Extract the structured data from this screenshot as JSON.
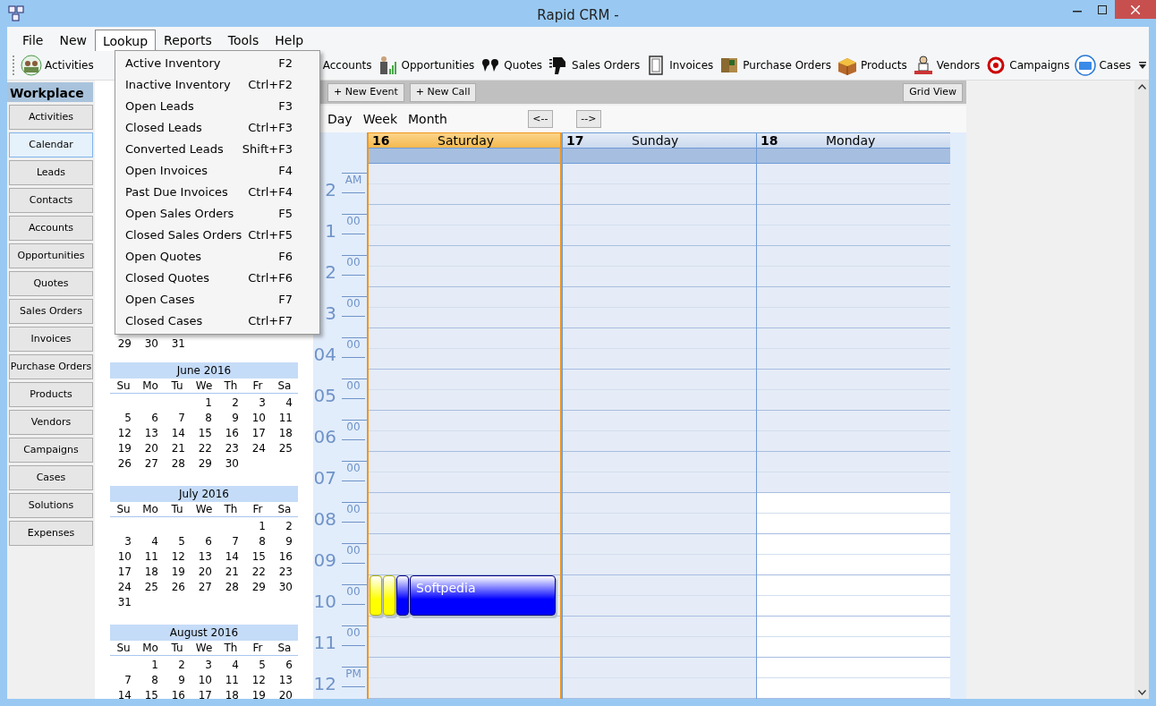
{
  "window": {
    "title": "Rapid CRM -"
  },
  "menu": [
    {
      "label": "File",
      "selected": false
    },
    {
      "label": "New",
      "selected": false
    },
    {
      "label": "Lookup",
      "selected": true
    },
    {
      "label": "Reports",
      "selected": false
    },
    {
      "label": "Tools",
      "selected": false
    },
    {
      "label": "Help",
      "selected": false
    }
  ],
  "lookup_menu": [
    {
      "label": "Active Inventory",
      "shortcut": "F2"
    },
    {
      "label": "Inactive Inventory",
      "shortcut": "Ctrl+F2"
    },
    {
      "label": "Open Leads",
      "shortcut": "F3"
    },
    {
      "label": "Closed Leads",
      "shortcut": "Ctrl+F3"
    },
    {
      "label": "Converted Leads",
      "shortcut": "Shift+F3"
    },
    {
      "label": "Open Invoices",
      "shortcut": "F4"
    },
    {
      "label": "Past Due Invoices",
      "shortcut": "Ctrl+F4"
    },
    {
      "label": "Open Sales Orders",
      "shortcut": "F5"
    },
    {
      "label": "Closed Sales Orders",
      "shortcut": "Ctrl+F5"
    },
    {
      "label": "Open Quotes",
      "shortcut": "F6"
    },
    {
      "label": "Closed Quotes",
      "shortcut": "Ctrl+F6"
    },
    {
      "label": "Open Cases",
      "shortcut": "F7"
    },
    {
      "label": "Closed Cases",
      "shortcut": "Ctrl+F7"
    }
  ],
  "toolbar": [
    {
      "label": "Activities"
    },
    {
      "label": "Accounts"
    },
    {
      "label": "Opportunities"
    },
    {
      "label": "Quotes"
    },
    {
      "label": "Sales Orders"
    },
    {
      "label": "Invoices"
    },
    {
      "label": "Purchase Orders"
    },
    {
      "label": "Products"
    },
    {
      "label": "Vendors"
    },
    {
      "label": "Campaigns"
    },
    {
      "label": "Cases"
    }
  ],
  "sidebar": {
    "title": "Workplace",
    "items": [
      {
        "label": "Activities",
        "selected": false
      },
      {
        "label": "Calendar",
        "selected": true
      },
      {
        "label": "Leads",
        "selected": false
      },
      {
        "label": "Contacts",
        "selected": false
      },
      {
        "label": "Accounts",
        "selected": false
      },
      {
        "label": "Opportunities",
        "selected": false
      },
      {
        "label": "Quotes",
        "selected": false
      },
      {
        "label": "Sales Orders",
        "selected": false
      },
      {
        "label": "Invoices",
        "selected": false
      },
      {
        "label": "Purchase Orders",
        "selected": false
      },
      {
        "label": "Products",
        "selected": false
      },
      {
        "label": "Vendors",
        "selected": false
      },
      {
        "label": "Campaigns",
        "selected": false
      },
      {
        "label": "Cases",
        "selected": false
      },
      {
        "label": "Solutions",
        "selected": false
      },
      {
        "label": "Expenses",
        "selected": false
      }
    ]
  },
  "mini_calendars": [
    {
      "weeks": [
        [
          "29",
          "30",
          "31"
        ]
      ]
    },
    {
      "title": "June 2016",
      "weekdays": [
        "Su",
        "Mo",
        "Tu",
        "We",
        "Th",
        "Fr",
        "Sa"
      ],
      "weeks": [
        [
          "1",
          "2",
          "3",
          "4"
        ],
        [
          "5",
          "6",
          "7",
          "8",
          "9",
          "10",
          "11"
        ],
        [
          "12",
          "13",
          "14",
          "15",
          "16",
          "17",
          "18"
        ],
        [
          "19",
          "20",
          "21",
          "22",
          "23",
          "24",
          "25"
        ],
        [
          "26",
          "27",
          "28",
          "29",
          "30"
        ]
      ]
    },
    {
      "title": "July 2016",
      "weekdays": [
        "Su",
        "Mo",
        "Tu",
        "We",
        "Th",
        "Fr",
        "Sa"
      ],
      "weeks": [
        [
          "1",
          "2"
        ],
        [
          "3",
          "4",
          "5",
          "6",
          "7",
          "8",
          "9"
        ],
        [
          "10",
          "11",
          "12",
          "13",
          "14",
          "15",
          "16"
        ],
        [
          "17",
          "18",
          "19",
          "20",
          "21",
          "22",
          "23"
        ],
        [
          "24",
          "25",
          "26",
          "27",
          "28",
          "29",
          "30"
        ],
        [
          "31"
        ]
      ]
    },
    {
      "title": "August 2016",
      "weekdays": [
        "Su",
        "Mo",
        "Tu",
        "We",
        "Th",
        "Fr",
        "Sa"
      ],
      "weeks": [
        [
          "1",
          "2",
          "3",
          "4",
          "5",
          "6"
        ],
        [
          "7",
          "8",
          "9",
          "10",
          "11",
          "12",
          "13"
        ],
        [
          "14",
          "15",
          "16",
          "17",
          "18",
          "19",
          "20"
        ]
      ]
    }
  ],
  "calendar": {
    "buttons": [
      "+ New Event",
      "+ New Call"
    ],
    "grid_view": "Grid View",
    "views": [
      "Day",
      "Week",
      "Month"
    ],
    "nav": [
      "<--",
      "-->"
    ],
    "hours": [
      {
        "label": "2",
        "suffix": "AM"
      },
      {
        "label": "1",
        "suffix": "00"
      },
      {
        "label": "2",
        "suffix": "00"
      },
      {
        "label": "3",
        "suffix": "00"
      },
      {
        "label": "04",
        "suffix": "00"
      },
      {
        "label": "05",
        "suffix": "00"
      },
      {
        "label": "06",
        "suffix": "00"
      },
      {
        "label": "07",
        "suffix": "00"
      },
      {
        "label": "08",
        "suffix": "00"
      },
      {
        "label": "09",
        "suffix": "00"
      },
      {
        "label": "10",
        "suffix": "00"
      },
      {
        "label": "11",
        "suffix": "00"
      },
      {
        "label": "12",
        "suffix": "PM"
      }
    ],
    "days": [
      {
        "number": "16",
        "name": "Saturday",
        "selected": true,
        "slots": [
          {
            "working": false
          },
          {
            "working": false
          },
          {
            "working": false
          },
          {
            "working": false
          },
          {
            "working": false
          },
          {
            "working": false
          },
          {
            "working": false
          },
          {
            "working": false
          },
          {
            "working": false
          },
          {
            "working": false
          },
          {
            "working": false,
            "events": [
              {
                "color": "#ffff00"
              },
              {
                "color": "#ffff00"
              },
              {
                "color": "#0000ff"
              },
              {
                "color": "#0000ff",
                "title": "Softpedia"
              }
            ]
          },
          {
            "working": false
          },
          {
            "working": false
          }
        ]
      },
      {
        "number": "17",
        "name": "Sunday",
        "selected": false,
        "slots": [
          {
            "working": false
          },
          {
            "working": false
          },
          {
            "working": false
          },
          {
            "working": false
          },
          {
            "working": false
          },
          {
            "working": false
          },
          {
            "working": false
          },
          {
            "working": false
          },
          {
            "working": false
          },
          {
            "working": false
          },
          {
            "working": false
          },
          {
            "working": false
          },
          {
            "working": false
          }
        ]
      },
      {
        "number": "18",
        "name": "Monday",
        "selected": false,
        "slots": [
          {
            "working": false
          },
          {
            "working": false
          },
          {
            "working": false
          },
          {
            "working": false
          },
          {
            "working": false
          },
          {
            "working": false
          },
          {
            "working": false
          },
          {
            "working": false
          },
          {
            "working": true
          },
          {
            "working": true
          },
          {
            "working": true
          },
          {
            "working": true
          },
          {
            "working": true
          }
        ]
      }
    ]
  }
}
